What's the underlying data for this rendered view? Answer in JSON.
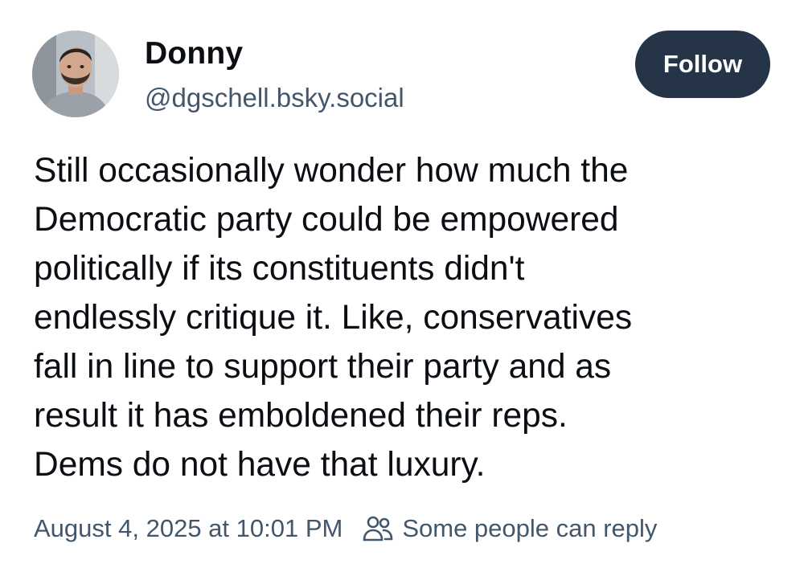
{
  "author": {
    "display_name": "Donny",
    "handle": "@dgschell.bsky.social",
    "avatar_icon": "profile-photo"
  },
  "follow_button": {
    "label": "Follow"
  },
  "post": {
    "text_lines": [
      "Still occasionally wonder how much the",
      "Democratic party could be empowered",
      "politically if its constituents didn't",
      "endlessly critique it. Like, conservatives",
      "fall in line to support their party and as",
      "result it has emboldened their reps.",
      "Dems do not have that luxury."
    ],
    "timestamp": "August 4, 2025 at 10:01 PM",
    "reply_setting": "Some people can reply",
    "reply_setting_icon": "people-icon"
  },
  "colors": {
    "button_bg": "#253446",
    "meta_text": "#42576c",
    "body_text": "#0b0f14"
  }
}
